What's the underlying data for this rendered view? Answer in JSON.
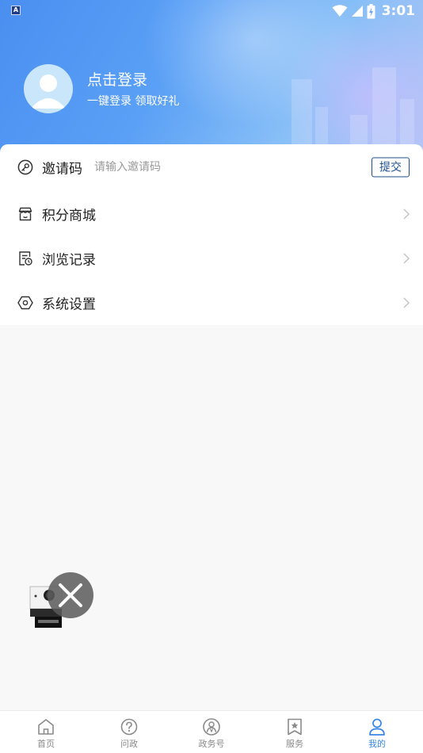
{
  "status_bar": {
    "notification_letter": "A",
    "time": "3:01"
  },
  "profile": {
    "title": "点击登录",
    "subtitle": "一键登录  领取好礼"
  },
  "menu": {
    "invite": {
      "label": "邀请码",
      "placeholder": "请输入邀请码",
      "value": "",
      "submit_label": "提交"
    },
    "items": [
      {
        "label": "积分商城",
        "icon": "store-icon"
      },
      {
        "label": "浏览记录",
        "icon": "history-icon"
      },
      {
        "label": "系统设置",
        "icon": "settings-icon"
      }
    ]
  },
  "tabbar": {
    "tabs": [
      {
        "label": "首页",
        "icon": "home-icon",
        "active": false
      },
      {
        "label": "问政",
        "icon": "question-icon",
        "active": false
      },
      {
        "label": "政务号",
        "icon": "gov-account-icon",
        "active": false
      },
      {
        "label": "服务",
        "icon": "service-bookmark-icon",
        "active": false
      },
      {
        "label": "我的",
        "icon": "user-icon",
        "active": true
      }
    ],
    "active_color": "#3a86e8",
    "inactive_color": "#8a8a8a"
  },
  "colors": {
    "header_gradient_start": "#4a8ff0",
    "header_gradient_end": "#b6c4f6",
    "submit_border": "#1d4f8f",
    "page_background": "#f8f8f9"
  }
}
